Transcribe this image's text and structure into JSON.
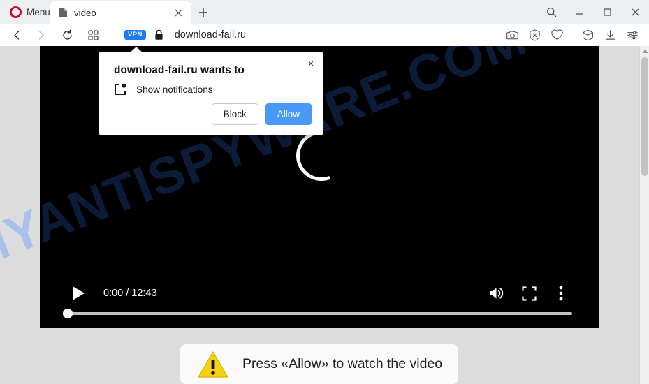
{
  "window": {
    "menu_label": "Menu",
    "opera_logo": "opera-o-icon",
    "controls": {
      "search": "search-icon",
      "minimize": "minimize-icon",
      "maximize": "maximize-icon",
      "close": "close-icon"
    }
  },
  "tabs": [
    {
      "title": "video",
      "favicon": "page-icon",
      "close": "close-icon",
      "active": true
    }
  ],
  "newtab_label": "+",
  "toolbar": {
    "back": "back-arrow-icon",
    "forward": "forward-arrow-icon",
    "reload": "reload-icon",
    "speeddial": "grid-icon",
    "vpn_badge": "VPN",
    "lock": "lock-icon",
    "url": "download-fail.ru",
    "right_icons": [
      "camera-snapshot-icon",
      "ad-blocker-shield-icon",
      "heart-icon",
      "cube-workspaces-icon",
      "downloads-icon",
      "easy-setup-sliders-icon"
    ]
  },
  "dialog": {
    "title": "download-fail.ru wants to",
    "permission_icon": "notifications-icon",
    "permission_label": "Show notifications",
    "block_label": "Block",
    "allow_label": "Allow",
    "close_glyph": "×",
    "allow_color": "#4a9af5"
  },
  "video": {
    "play_icon": "play-icon",
    "current_time": "0:00",
    "separator": "/",
    "duration": "12:43",
    "time_display": "0:00 / 12:43",
    "volume_icon": "volume-icon",
    "fullscreen_icon": "fullscreen-icon",
    "more_icon": "kebab-menu-icon",
    "progress_percent": 0,
    "loading": true
  },
  "banner": {
    "warning_icon": "warning-triangle-icon",
    "text": "Press «Allow» to watch the video",
    "icon_color": "#f5d211"
  },
  "watermark": {
    "text": "MYANTISPYWARE.COM",
    "outside_color": "#a9c0ea",
    "inside_color": "#0c1b38"
  },
  "scrollbar": {
    "up_arrow": "scroll-up-arrow-icon"
  }
}
